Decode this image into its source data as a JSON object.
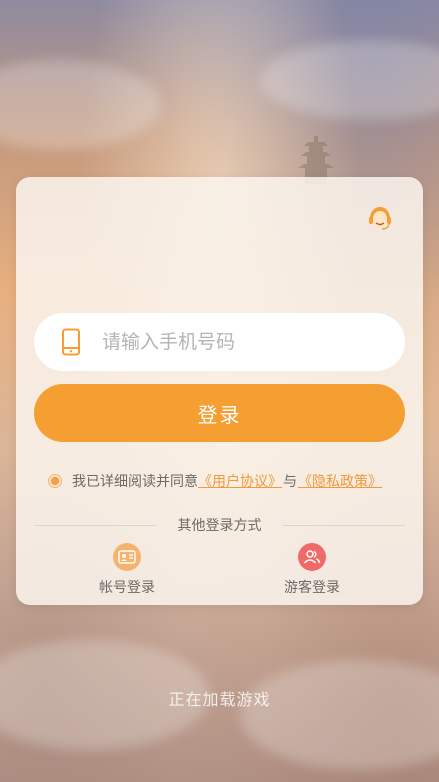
{
  "colors": {
    "accent": "#f59f33",
    "link": "#f29a3a",
    "account_icon_bg": "#f7b36d",
    "guest_icon_bg": "#f06a6a",
    "card_bg": "#faf4ee"
  },
  "login_card": {
    "support_icon": "customer-service-icon",
    "phone": {
      "icon": "mobile-phone-icon",
      "placeholder": "请输入手机号码",
      "value": ""
    },
    "login_button_label": "登录",
    "agreement": {
      "checked": true,
      "prefix": "我已详细阅读并同意",
      "user_agreement": "《用户协议》",
      "conjunction": "与",
      "privacy_policy": "《隐私政策》"
    },
    "other_methods": {
      "title": "其他登录方式",
      "account": {
        "icon": "id-card-icon",
        "label": "帐号登录"
      },
      "guest": {
        "icon": "users-icon",
        "label": "游客登录"
      }
    }
  },
  "status": {
    "loading_text": "正在加载游戏"
  }
}
